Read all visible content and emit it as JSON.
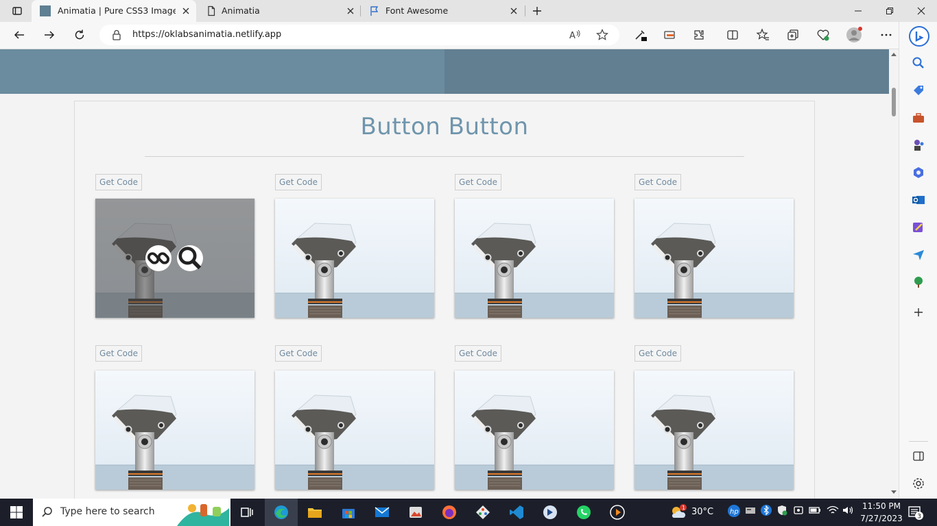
{
  "browser": {
    "tabs": [
      {
        "title": "Animatia | Pure CSS3 Image Hove",
        "active": true
      },
      {
        "title": "Animatia",
        "active": false
      },
      {
        "title": "Font Awesome",
        "active": false
      }
    ],
    "address": "https://oklabsanimatia.netlify.app"
  },
  "page": {
    "section_title": "Button Button",
    "get_code_label": "Get Code",
    "grid": {
      "rows": 2,
      "columns": 4,
      "hovered_card": 1
    }
  },
  "taskbar": {
    "search_placeholder": "Type here to search",
    "temperature": "30°C",
    "time": "11:50 PM",
    "date": "7/27/2023",
    "notification_count": "3",
    "weather_badge": "1"
  },
  "colors": {
    "banner_left": "#6a8c9e",
    "banner_right": "#627f92",
    "title": "#6f95ac",
    "taskbar": "#1c1f2a"
  },
  "icons": [
    "tab-actions-icon",
    "page-favicon",
    "document-icon",
    "flag-icon",
    "back-icon",
    "forward-icon",
    "refresh-icon",
    "lock-icon",
    "read-aloud-icon",
    "favorite-star-icon",
    "link-icon",
    "search-icon",
    "bing-icon",
    "windows-start-icon"
  ]
}
